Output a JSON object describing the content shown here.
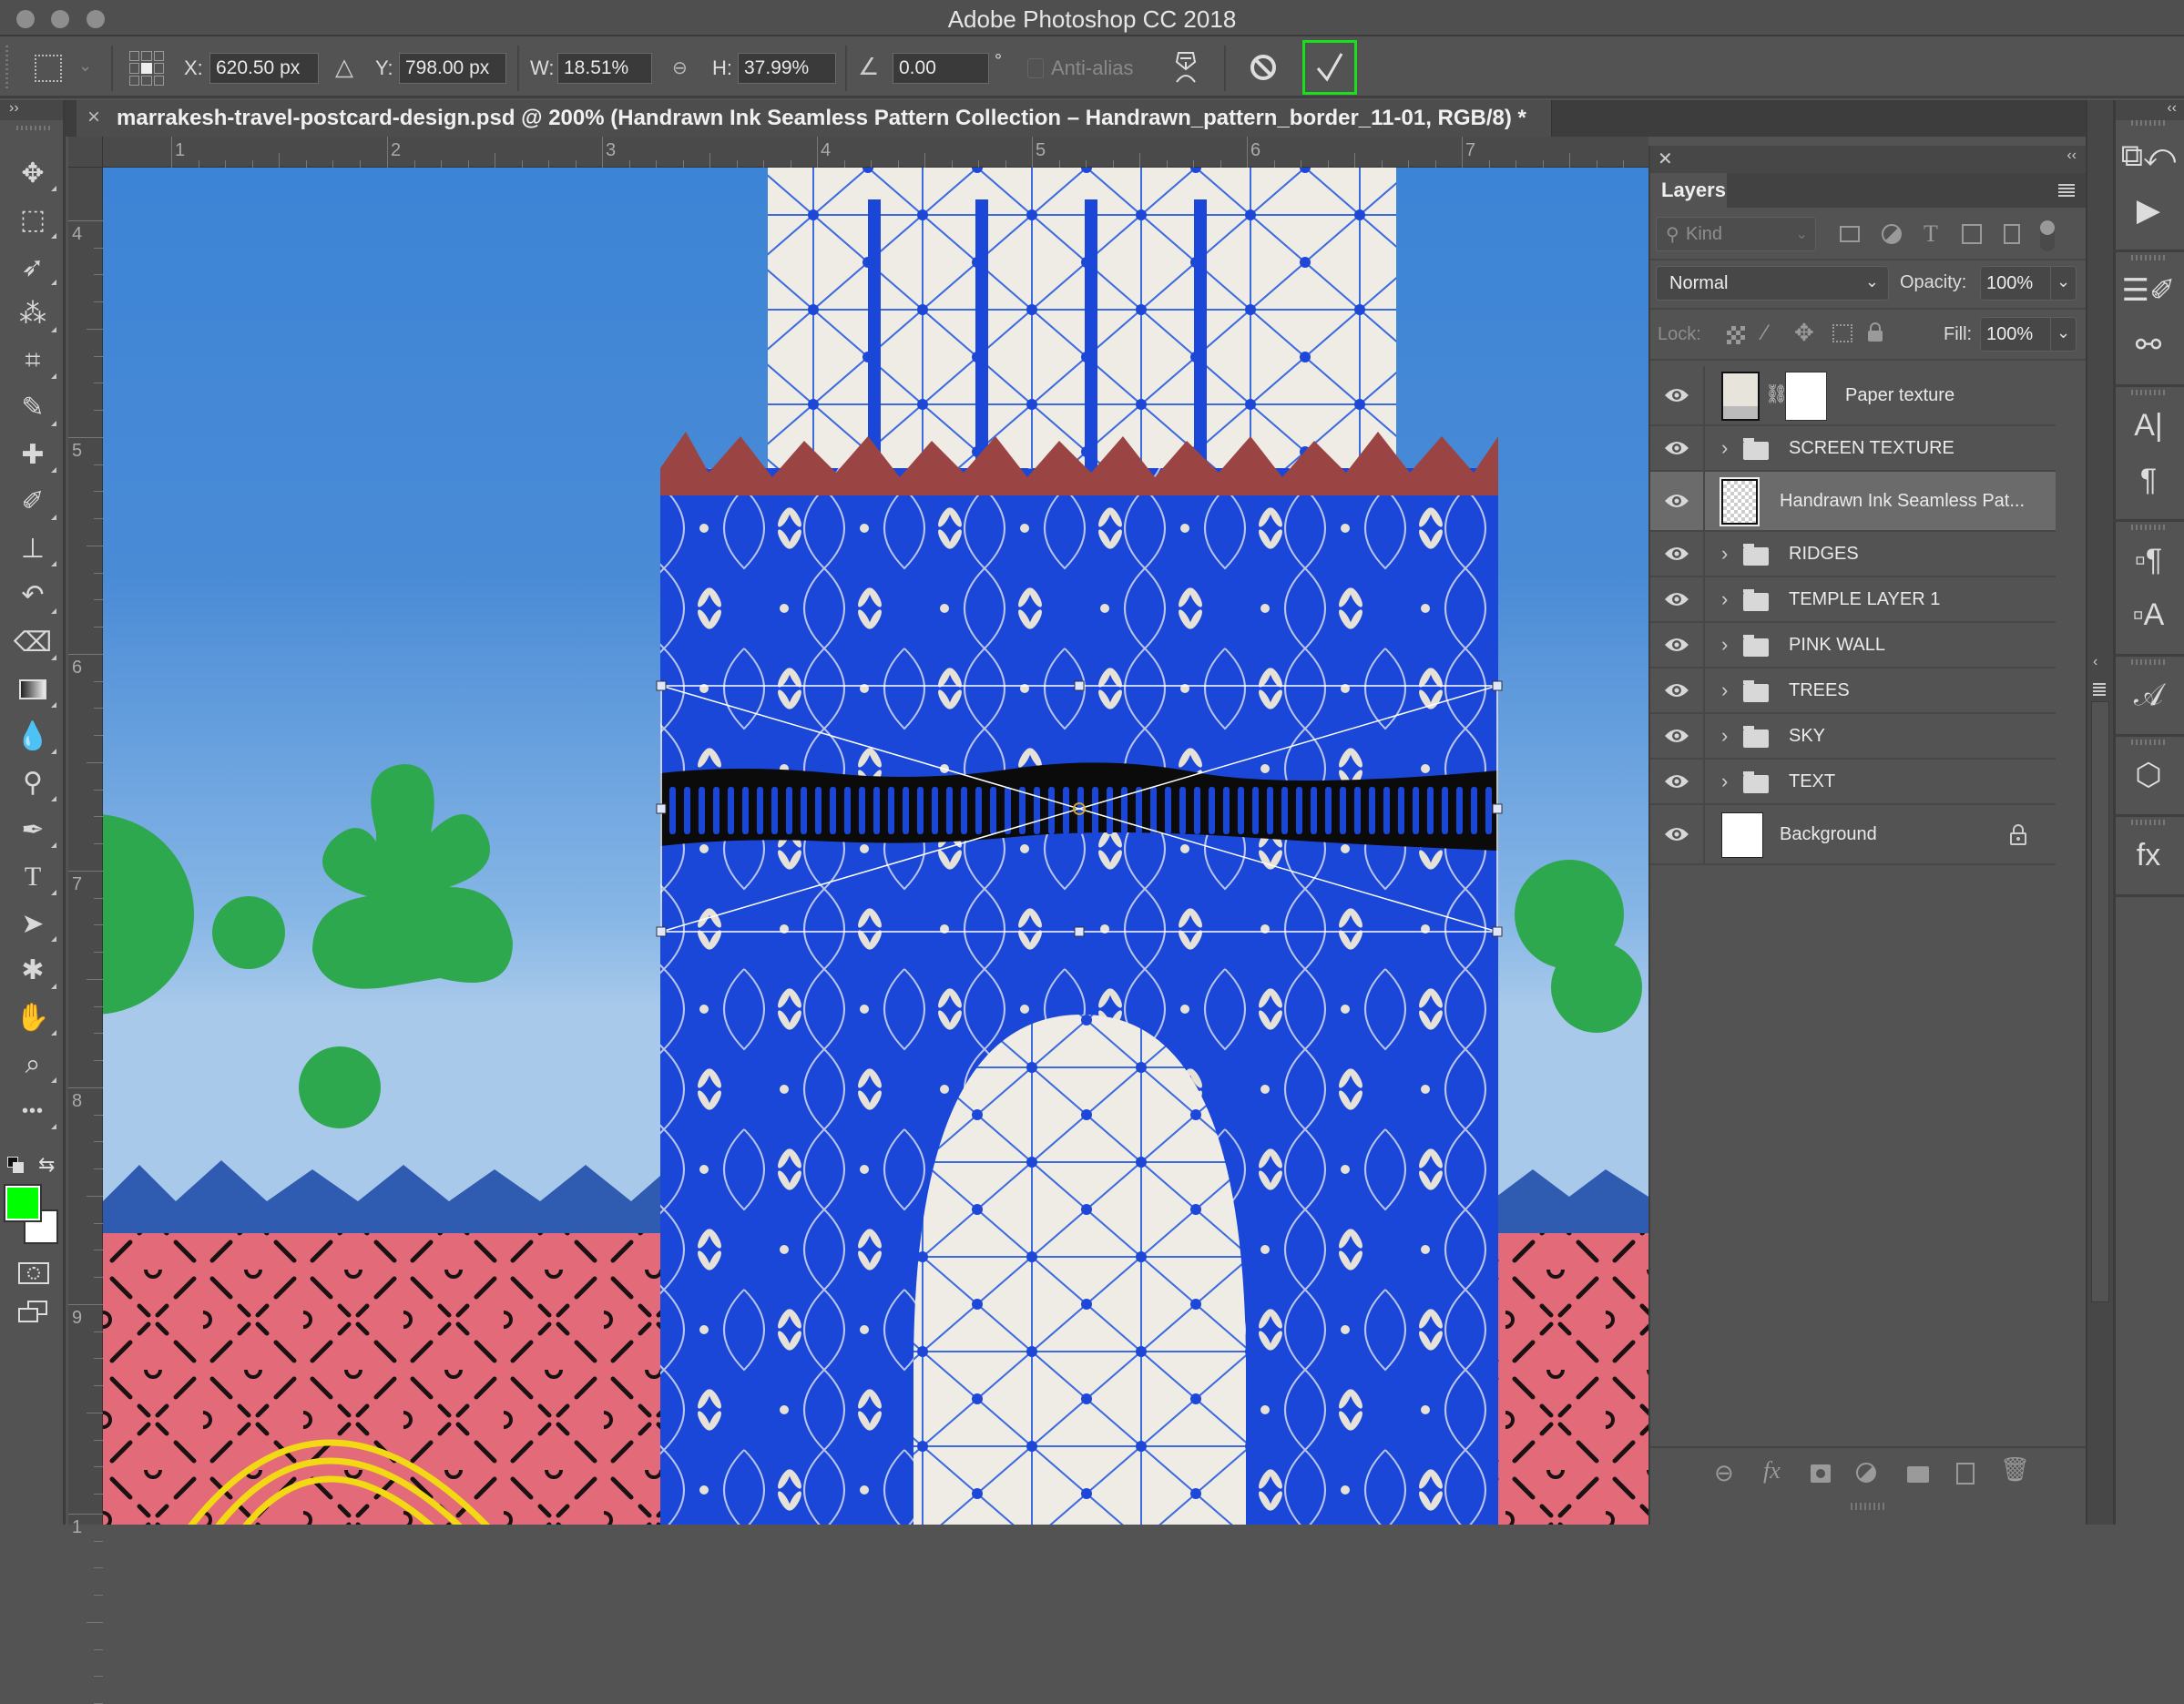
{
  "app": {
    "title": "Adobe Photoshop CC 2018"
  },
  "options_bar": {
    "x_label": "X:",
    "x_value": "620.50 px",
    "y_label": "Y:",
    "y_value": "798.00 px",
    "w_label": "W:",
    "w_value": "18.51%",
    "h_label": "H:",
    "h_value": "37.99%",
    "angle_value": "0.00",
    "angle_unit": "°",
    "anti_alias_label": "Anti-alias",
    "anti_alias_checked": false,
    "commit_color": "#19e01a"
  },
  "document_tab": {
    "title": "marrakesh-travel-postcard-design.psd @ 200% (Handrawn Ink Seamless Pattern Collection – Handrawn_pattern_border_11-01, RGB/8) *",
    "close_glyph": "×"
  },
  "rulers": {
    "top_labels": [
      "1",
      "2",
      "3",
      "4",
      "5",
      "6",
      "7"
    ],
    "left_labels": [
      "4",
      "5",
      "6",
      "7",
      "8",
      "9",
      "1"
    ]
  },
  "toolbar": {
    "expand_glyph": "››",
    "tools": [
      {
        "name": "move-tool"
      },
      {
        "name": "marquee-tool"
      },
      {
        "name": "lasso-tool"
      },
      {
        "name": "magic-wand-tool"
      },
      {
        "name": "crop-tool"
      },
      {
        "name": "eyedropper-tool"
      },
      {
        "name": "healing-brush-tool"
      },
      {
        "name": "brush-tool"
      },
      {
        "name": "clone-stamp-tool"
      },
      {
        "name": "history-brush-tool"
      },
      {
        "name": "eraser-tool"
      },
      {
        "name": "gradient-tool"
      },
      {
        "name": "blur-tool"
      },
      {
        "name": "dodge-tool"
      },
      {
        "name": "pen-tool"
      },
      {
        "name": "type-tool"
      },
      {
        "name": "path-selection-tool"
      },
      {
        "name": "custom-shape-tool"
      },
      {
        "name": "hand-tool"
      },
      {
        "name": "zoom-tool"
      },
      {
        "name": "more-tools"
      }
    ],
    "foreground_color": "#00ff00",
    "background_color": "#ffffff"
  },
  "layers_panel": {
    "title": "Layers",
    "filter_placeholder": "Kind",
    "blend_mode": "Normal",
    "opacity_label": "Opacity:",
    "opacity_value": "100%",
    "lock_label": "Lock:",
    "fill_label": "Fill:",
    "fill_value": "100%",
    "layers": [
      {
        "name": "Paper texture",
        "type": "adjustment",
        "visible": true,
        "selected": false
      },
      {
        "name": "SCREEN TEXTURE",
        "type": "group",
        "visible": true,
        "selected": false
      },
      {
        "name": "Handrawn Ink Seamless Pat...",
        "type": "smart-object",
        "visible": true,
        "selected": true
      },
      {
        "name": "RIDGES",
        "type": "group",
        "visible": true,
        "selected": false
      },
      {
        "name": "TEMPLE  LAYER 1",
        "type": "group",
        "visible": true,
        "selected": false
      },
      {
        "name": "PINK WALL",
        "type": "group",
        "visible": true,
        "selected": false
      },
      {
        "name": "TREES",
        "type": "group",
        "visible": true,
        "selected": false
      },
      {
        "name": "SKY",
        "type": "group",
        "visible": true,
        "selected": false
      },
      {
        "name": "TEXT",
        "type": "group",
        "visible": true,
        "selected": false
      },
      {
        "name": "Background",
        "type": "background",
        "visible": true,
        "selected": false,
        "locked": true
      }
    ],
    "footer_fx": "fx"
  },
  "canvas": {
    "colors": {
      "sky": "#4a8bd6",
      "sky_light": "#a3c6ea",
      "temple_blue": "#1a47d8",
      "ridge_red": "#9a4543",
      "pink_wall": "#e36a78",
      "tree_green": "#2ea84e",
      "ridge_blue": "#2f5bb0",
      "pattern_cream": "#efece6",
      "arc_yellow": "#f3d914"
    }
  }
}
